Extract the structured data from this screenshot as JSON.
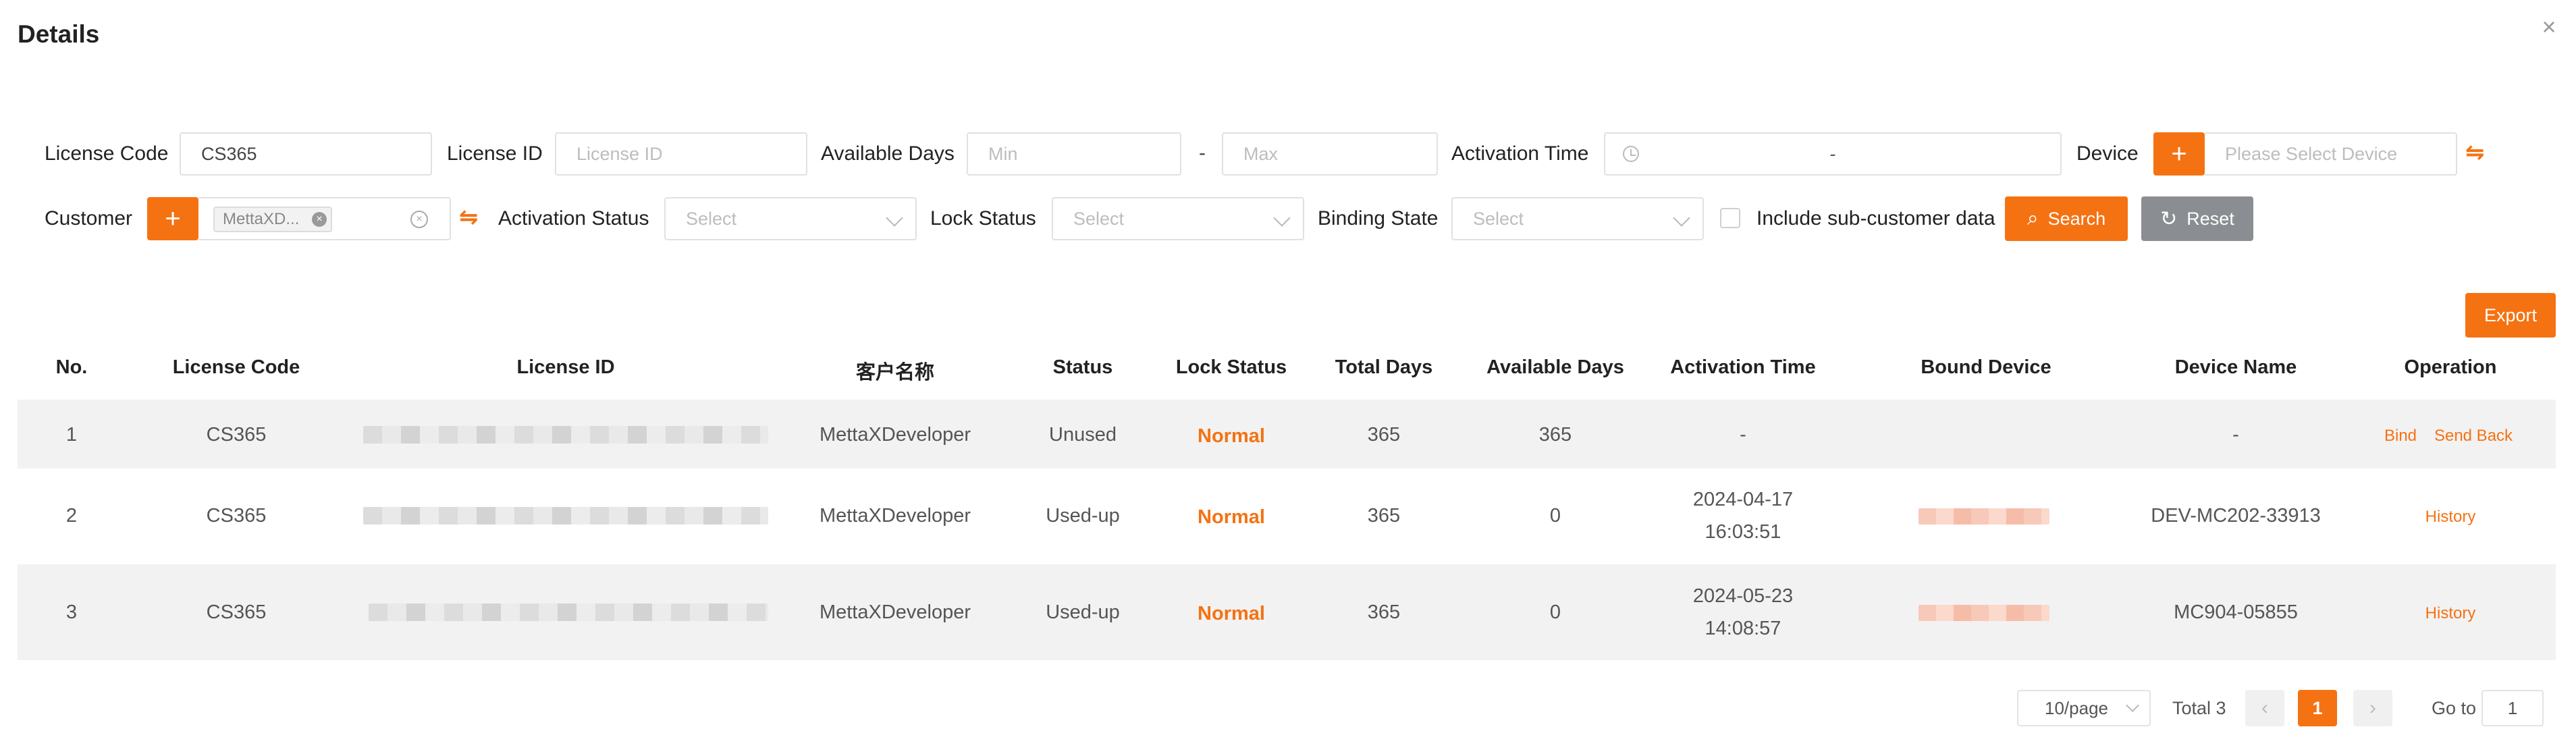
{
  "dialog": {
    "title": "Details",
    "close_symbol": "×"
  },
  "filters": {
    "license_code": {
      "label": "License Code",
      "value": "CS365"
    },
    "license_id": {
      "label": "License ID",
      "placeholder": "License ID"
    },
    "available_days": {
      "label": "Available Days",
      "min_placeholder": "Min",
      "separator": "-",
      "max_placeholder": "Max"
    },
    "activation_time": {
      "label": "Activation Time",
      "separator": "-"
    },
    "device": {
      "label": "Device",
      "placeholder": "Please Select Device",
      "add_symbol": "+",
      "swap_symbol": "⇋"
    },
    "customer": {
      "label": "Customer",
      "add_symbol": "+",
      "tag": "MettaXD...",
      "tag_remove": "×",
      "clear_symbol": "×",
      "swap_symbol": "⇋"
    },
    "activation_status": {
      "label": "Activation Status",
      "placeholder": "Select"
    },
    "lock_status": {
      "label": "Lock Status",
      "placeholder": "Select"
    },
    "binding_state": {
      "label": "Binding State",
      "placeholder": "Select"
    },
    "include_sub": {
      "label": "Include sub-customer data",
      "checked": false
    },
    "search_button": "Search",
    "reset_button": "Reset",
    "search_icon_glyph": "⌕",
    "reset_icon_glyph": "↻"
  },
  "export_button": "Export",
  "table": {
    "columns": [
      "No.",
      "License Code",
      "License ID",
      "客户名称",
      "Status",
      "Lock Status",
      "Total Days",
      "Available Days",
      "Activation Time",
      "Bound Device",
      "Device Name",
      "Operation"
    ],
    "rows": [
      {
        "no": "1",
        "license_code": "CS365",
        "customer": "MettaXDeveloper",
        "status": "Unused",
        "lock_status": "Normal",
        "total_days": "365",
        "available_days": "365",
        "activation_time": [
          "-"
        ],
        "device_name": "-",
        "operations": [
          "Bind",
          "Send Back"
        ]
      },
      {
        "no": "2",
        "license_code": "CS365",
        "customer": "MettaXDeveloper",
        "status": "Used-up",
        "lock_status": "Normal",
        "total_days": "365",
        "available_days": "0",
        "activation_time": [
          "2024-04-17",
          "16:03:51"
        ],
        "device_name": "DEV-MC202-33913",
        "operations": [
          "History"
        ]
      },
      {
        "no": "3",
        "license_code": "CS365",
        "customer": "MettaXDeveloper",
        "status": "Used-up",
        "lock_status": "Normal",
        "total_days": "365",
        "available_days": "0",
        "activation_time": [
          "2024-05-23",
          "14:08:57"
        ],
        "device_name": "MC904-05855",
        "operations": [
          "History"
        ]
      }
    ]
  },
  "pagination": {
    "page_size": "10/page",
    "total": "Total 3",
    "prev_symbol": "‹",
    "current_page": "1",
    "next_symbol": "›",
    "goto_label": "Go to",
    "goto_value": "1"
  },
  "colors": {
    "accent": "#f57212",
    "reset_gray": "#8a8d91",
    "row_stripe": "#f2f2f2"
  }
}
